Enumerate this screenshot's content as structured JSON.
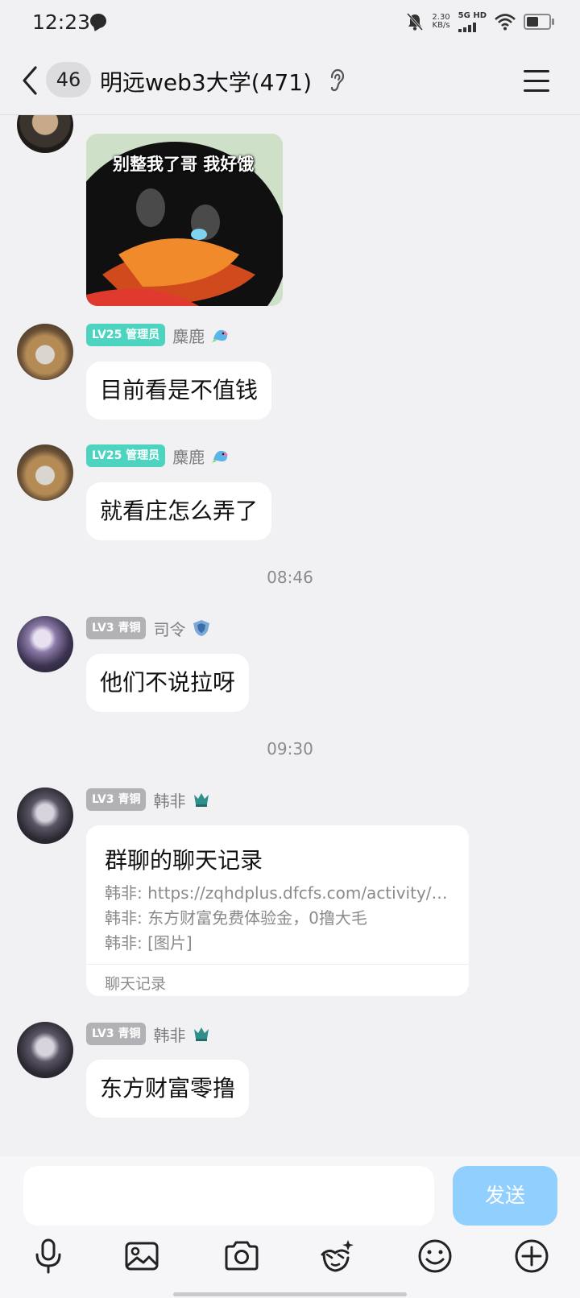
{
  "status_bar": {
    "time": "12:23",
    "net_speed_value": "2.30",
    "net_speed_unit": "KB/s",
    "network_type": "5G HD"
  },
  "header": {
    "unread_count": "46",
    "title": "明远web3大学(471)"
  },
  "messages": [
    {
      "type": "sticker",
      "sticker_text": "别整我了哥 我好饿"
    },
    {
      "type": "text",
      "level": "LV25 管理员",
      "level_style": "admin",
      "name": "麋鹿",
      "badge_icon": "dragon-icon",
      "text": "目前看是不值钱"
    },
    {
      "type": "text",
      "level": "LV25 管理员",
      "level_style": "admin",
      "name": "麋鹿",
      "badge_icon": "dragon-icon",
      "text": "就看庄怎么弄了"
    },
    {
      "type": "time",
      "text": "08:46"
    },
    {
      "type": "text",
      "level": "LV3 青铜",
      "level_style": "bronze",
      "name": "司令",
      "badge_icon": "shield-icon",
      "text": "他们不说拉呀"
    },
    {
      "type": "time",
      "text": "09:30"
    },
    {
      "type": "card",
      "level": "LV3 青铜",
      "level_style": "bronze",
      "name": "韩非",
      "badge_icon": "crown-icon",
      "card_title": "群聊的聊天记录",
      "card_lines": [
        "韩非: https://zqhdplus.dfcfs.com/activity/…",
        "韩非: 东方财富免费体验金，0撸大毛",
        "韩非: [图片]"
      ],
      "card_footer": "聊天记录"
    },
    {
      "type": "text",
      "level": "LV3 青铜",
      "level_style": "bronze",
      "name": "韩非",
      "badge_icon": "crown-icon",
      "text": "东方财富零撸"
    }
  ],
  "input": {
    "value": "",
    "send_label": "发送"
  },
  "colors": {
    "background": "#f1f1f3",
    "admin_badge": "#4cd4c0",
    "bronze_badge": "#b2b2b6",
    "send_button": "#91cfff"
  }
}
